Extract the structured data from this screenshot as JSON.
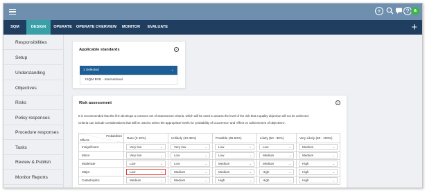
{
  "topbar": {
    "icons": [
      "menu-icon",
      "add-circle-icon",
      "search-icon",
      "chat-icon",
      "help-icon",
      "user-avatar"
    ],
    "avatar_initial": "a"
  },
  "nav": {
    "items": [
      {
        "label": "SQM",
        "active": false
      },
      {
        "label": "DESIGN",
        "active": true
      },
      {
        "label": "OPERATE",
        "active": false
      },
      {
        "label": "OPERATE OVERVIEW",
        "active": false
      },
      {
        "label": "MONITOR",
        "active": false
      },
      {
        "label": "EVALUATE",
        "active": false
      }
    ],
    "add_label": "+"
  },
  "sidebar": {
    "items": [
      {
        "label": "Responsibilities"
      },
      {
        "label": "Setup"
      },
      {
        "label": "Understanding"
      },
      {
        "label": "Objectives"
      },
      {
        "label": "Risks"
      },
      {
        "label": "Policy responses"
      },
      {
        "label": "Procedure responses"
      },
      {
        "label": "Tasks"
      },
      {
        "label": "Review & Publish"
      },
      {
        "label": "Monitor Reports"
      }
    ]
  },
  "standards": {
    "title": "Applicable standards",
    "selected_label": "1 Selected",
    "option": "ISQM BVE - International"
  },
  "risk": {
    "title": "Risk assessment",
    "description_1": "It is recommended that the firm develops a common set of assessment criteria, which will be used to assess the level of the risk that a quality objective will not be achieved.",
    "description_2": "Criteria can include considerations that will be used to select the appropriate levels for 'probability of occurrence' and 'effect on achievement of objectives'.",
    "corner_probabilities": "Probabilities",
    "corner_effects": "Effects",
    "columns": [
      "Rare (0-10%)",
      "Unlikely (10-35%)",
      "Possible (35-50%)",
      "Likely (50 - 80%)",
      "Very Likely (80 - 100%)"
    ],
    "rows": [
      {
        "effect": "Insignificant",
        "cells": [
          "Very low",
          "Very low",
          "Low",
          "Low",
          "Medium"
        ]
      },
      {
        "effect": "Minor",
        "cells": [
          "Very low",
          "Low",
          "Low",
          "Medium",
          "Medium"
        ]
      },
      {
        "effect": "Moderate",
        "cells": [
          "Low",
          "Low",
          "Medium",
          "Medium",
          "High"
        ]
      },
      {
        "effect": "Major",
        "cells": [
          "Low",
          "Medium",
          "Medium",
          "High",
          "High"
        ]
      },
      {
        "effect": "Catastrophic",
        "cells": [
          "Medium",
          "Medium",
          "High",
          "High",
          "High"
        ]
      }
    ],
    "highlight_color": "#e23b3b"
  }
}
